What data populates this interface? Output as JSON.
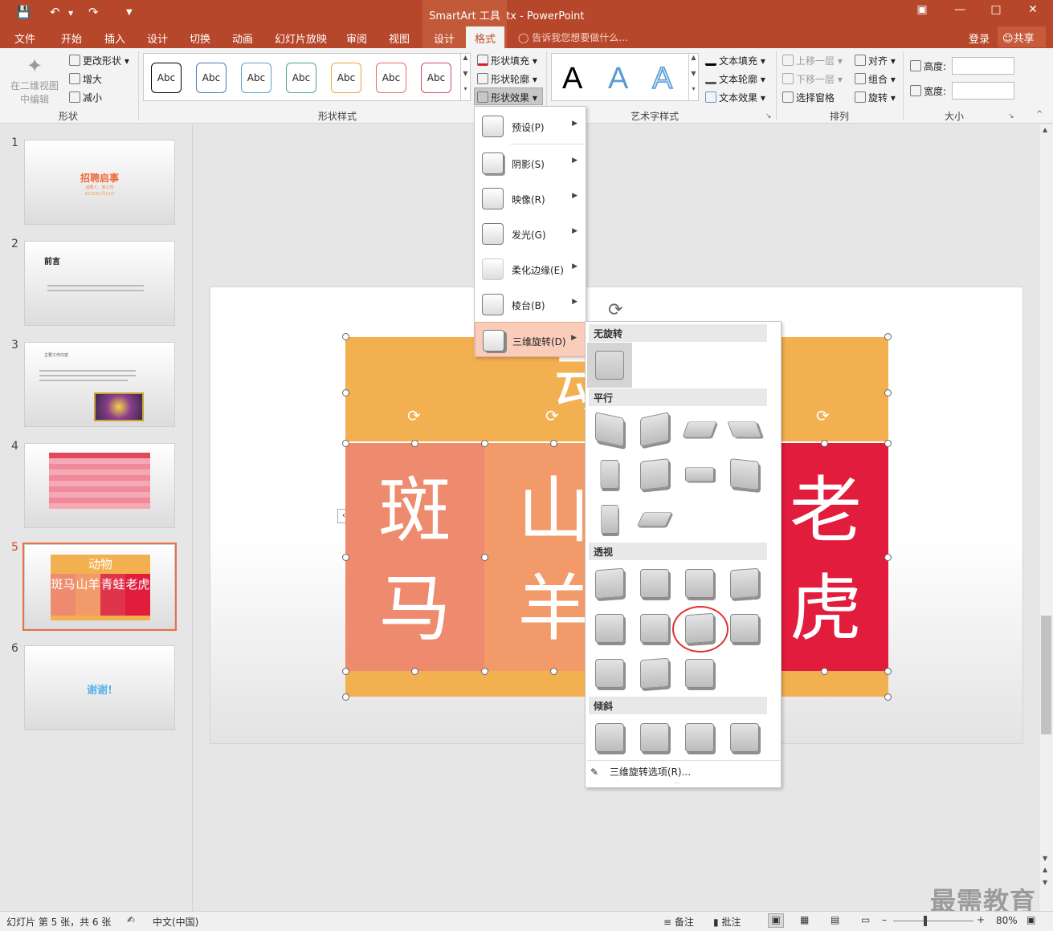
{
  "window": {
    "title": "谢谢.pptx - PowerPoint",
    "context_tools": "SmartArt 工具",
    "login": "登录",
    "share": "共享"
  },
  "tabs": [
    "文件",
    "开始",
    "插入",
    "设计",
    "切换",
    "动画",
    "幻灯片放映",
    "审阅",
    "视图",
    "设计",
    "格式"
  ],
  "active_tab": "格式",
  "tell_me": "告诉我您想要做什么...",
  "ribbon": {
    "shape_group": {
      "edit_2d": "在二维视图中编辑",
      "change_shape": "更改形状",
      "bigger": "增大",
      "smaller": "减小",
      "label": "形状"
    },
    "styles_group": {
      "label": "形状样式",
      "swatch_text": "Abc",
      "swatch_colors": [
        "#000000",
        "#4a7ab5",
        "#5e9fc9",
        "#4aa39a",
        "#f0a23c",
        "#e06e6e",
        "#d64a5c"
      ],
      "fill": "形状填充",
      "outline": "形状轮廓",
      "effects": "形状效果"
    },
    "wordart_group": {
      "label": "艺术字样式",
      "letter": "A",
      "text_fill": "文本填充",
      "text_outline": "文本轮廓",
      "text_effects": "文本效果"
    },
    "arrange_group": {
      "label": "排列",
      "bring_forward": "上移一层",
      "send_backward": "下移一层",
      "selection_pane": "选择窗格",
      "align": "对齐",
      "group": "组合",
      "rotate": "旋转"
    },
    "size_group": {
      "label": "大小",
      "height": "高度:",
      "width": "宽度:"
    }
  },
  "slides": [
    {
      "num": "1",
      "title": "招聘启事",
      "sub1": "诚聘人：某公司",
      "sub2": "2021年1月12日"
    },
    {
      "num": "2",
      "title": "前言"
    },
    {
      "num": "3",
      "title": "主要工作内容"
    },
    {
      "num": "4"
    },
    {
      "num": "5",
      "title": "动物",
      "items": [
        "斑马",
        "山羊",
        "青蛙",
        "老虎"
      ]
    },
    {
      "num": "6",
      "title": "谢谢!"
    }
  ],
  "smartart": {
    "top": "动",
    "cells": [
      {
        "text": "斑\n马",
        "color": "#ee8a6e"
      },
      {
        "text": "山\n羊",
        "color": "#f39a6b"
      },
      {
        "text": "老\n虎",
        "color": "#e21c3c"
      }
    ],
    "top_color": "#f2b050"
  },
  "effects_menu": [
    {
      "label": "预设(P)",
      "key": "P"
    },
    {
      "label": "阴影(S)",
      "key": "S"
    },
    {
      "label": "映像(R)",
      "key": "R"
    },
    {
      "label": "发光(G)",
      "key": "G"
    },
    {
      "label": "柔化边缘(E)",
      "key": "E"
    },
    {
      "label": "棱台(B)",
      "key": "B"
    },
    {
      "label": "三维旋转(D)",
      "key": "D",
      "active": true
    }
  ],
  "rotation_submenu": {
    "sections": [
      "无旋转",
      "平行",
      "透视",
      "倾斜"
    ],
    "counts": [
      1,
      10,
      11,
      4
    ],
    "options_label": "三维旋转选项(R)..."
  },
  "status": {
    "slide_info": "幻灯片 第 5 张，共 6 张",
    "language": "中文(中国)",
    "notes": "备注",
    "comments": "批注",
    "zoom": "80%"
  },
  "watermark": "最需教育"
}
